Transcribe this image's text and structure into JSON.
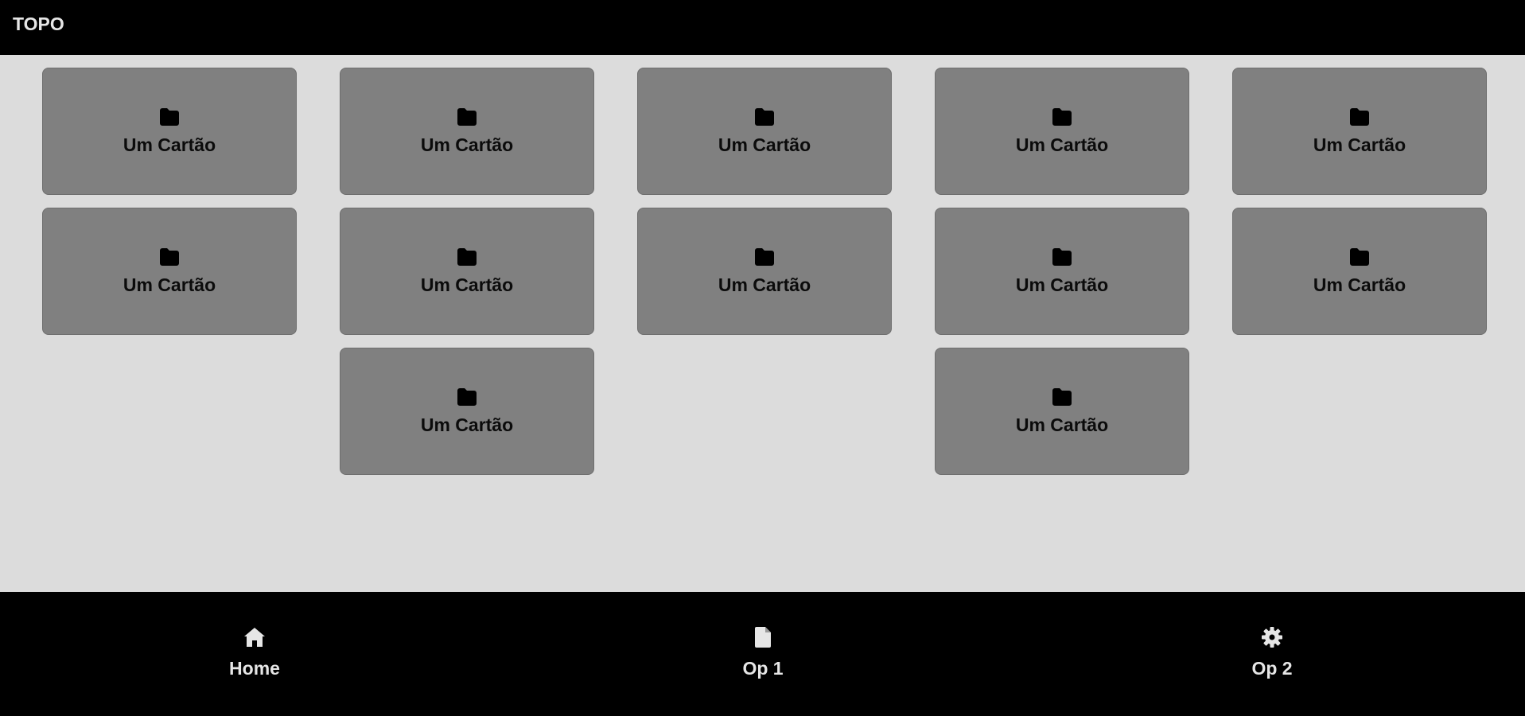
{
  "header": {
    "title": "TOPO"
  },
  "cards": [
    {
      "label": "Um Cartão",
      "icon": "folder-icon"
    },
    {
      "label": "Um Cartão",
      "icon": "folder-icon"
    },
    {
      "label": "Um Cartão",
      "icon": "folder-icon"
    },
    {
      "label": "Um Cartão",
      "icon": "folder-icon"
    },
    {
      "label": "Um Cartão",
      "icon": "folder-icon"
    },
    {
      "label": "Um Cartão",
      "icon": "folder-icon"
    },
    {
      "label": "Um Cartão",
      "icon": "folder-icon"
    },
    {
      "label": "Um Cartão",
      "icon": "folder-icon"
    },
    {
      "label": "Um Cartão",
      "icon": "folder-icon"
    },
    {
      "label": "Um Cartão",
      "icon": "folder-icon"
    },
    {
      "label": "Um Cartão",
      "icon": "folder-icon"
    },
    {
      "label": "Um Cartão",
      "icon": "folder-icon"
    }
  ],
  "bottom_nav": {
    "items": [
      {
        "label": "Home",
        "icon": "home-icon"
      },
      {
        "label": "Op 1",
        "icon": "file-icon"
      },
      {
        "label": "Op 2",
        "icon": "gear-icon"
      }
    ]
  },
  "colors": {
    "bars": "#000000",
    "background": "#dcdcdc",
    "card": "#808080",
    "bar_text": "#e6e6e6"
  }
}
